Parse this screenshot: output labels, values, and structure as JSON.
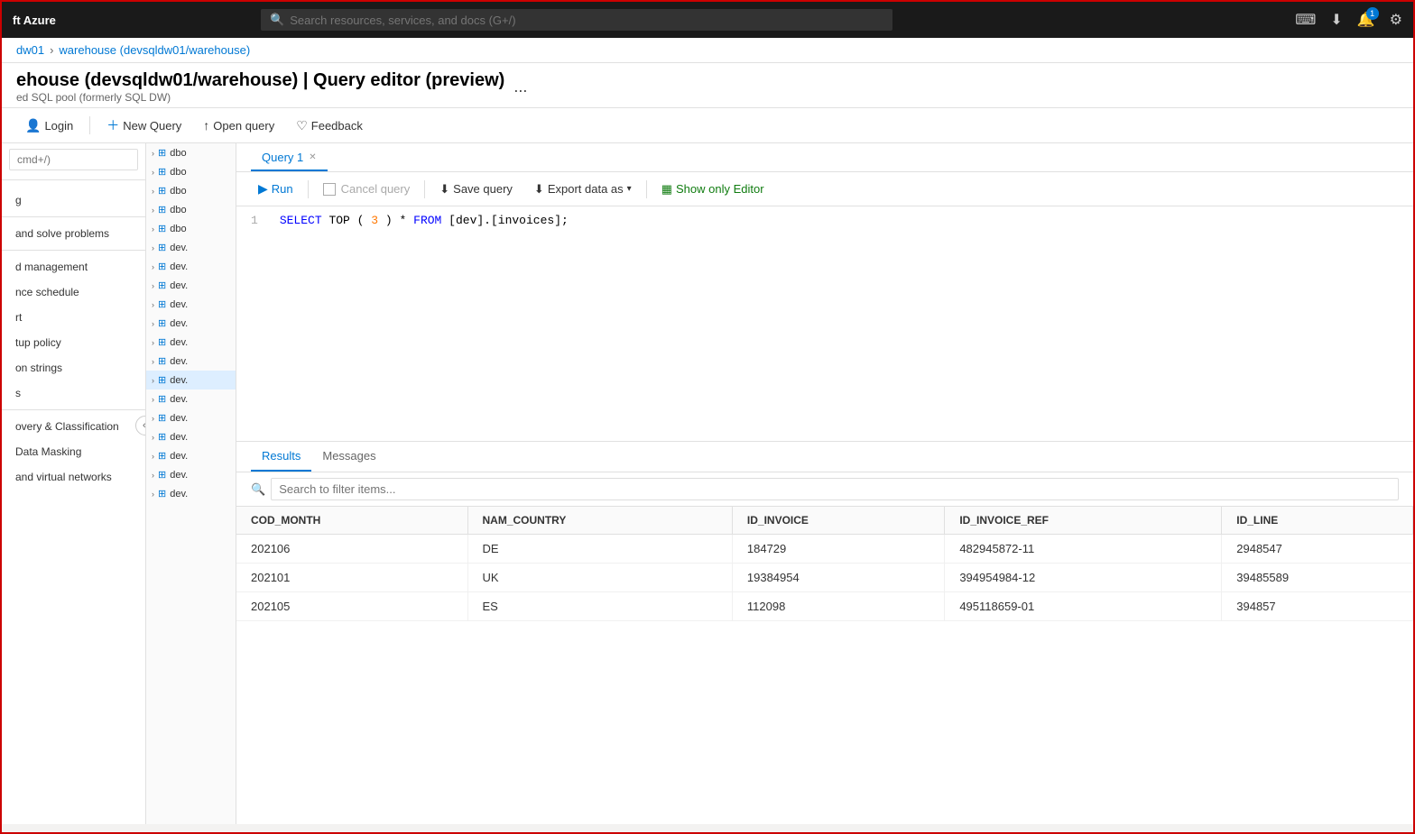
{
  "topbar": {
    "brand": "ft Azure",
    "search_placeholder": "Search resources, services, and docs (G+/)",
    "notification_count": "1"
  },
  "breadcrumb": {
    "parent": "dw01",
    "current": "warehouse (devsqldw01/warehouse)"
  },
  "page": {
    "title": "ehouse (devsqldw01/warehouse) | Query editor (preview)",
    "subtitle": "ed SQL pool (formerly SQL DW)",
    "ellipsis": "..."
  },
  "toolbar": {
    "login_label": "Login",
    "new_query_label": "New Query",
    "open_query_label": "Open query",
    "feedback_label": "Feedback"
  },
  "sidebar": {
    "search_placeholder": "cmd+/)",
    "items": [
      {
        "label": "g"
      },
      {
        "label": "and solve problems"
      },
      {
        "label": "d management"
      },
      {
        "label": "nce schedule"
      },
      {
        "label": "rt"
      },
      {
        "label": "tup policy"
      },
      {
        "label": "on strings"
      },
      {
        "label": "s"
      },
      {
        "label": "overy & Classification"
      },
      {
        "label": "Data Masking"
      },
      {
        "label": "and virtual networks"
      }
    ]
  },
  "tree": {
    "items": [
      {
        "label": "dbo",
        "selected": false
      },
      {
        "label": "dbo",
        "selected": false
      },
      {
        "label": "dbo",
        "selected": false
      },
      {
        "label": "dbo",
        "selected": false
      },
      {
        "label": "dbo",
        "selected": false
      },
      {
        "label": "dev.",
        "selected": false
      },
      {
        "label": "dev.",
        "selected": false
      },
      {
        "label": "dev.",
        "selected": false
      },
      {
        "label": "dev.",
        "selected": false
      },
      {
        "label": "dev.",
        "selected": false
      },
      {
        "label": "dev.",
        "selected": false
      },
      {
        "label": "dev.",
        "selected": false
      },
      {
        "label": "dev.",
        "selected": true
      },
      {
        "label": "dev.",
        "selected": false
      },
      {
        "label": "dev.",
        "selected": false
      },
      {
        "label": "dev.",
        "selected": false
      },
      {
        "label": "dev.",
        "selected": false
      },
      {
        "label": "dev.",
        "selected": false
      },
      {
        "label": "dev.",
        "selected": false
      }
    ]
  },
  "query_tab": {
    "label": "Query 1"
  },
  "editor": {
    "run_label": "Run",
    "cancel_label": "Cancel query",
    "save_label": "Save query",
    "export_label": "Export data as",
    "show_editor_label": "Show only Editor",
    "line_number": "1",
    "code_line": "SELECT TOP (3) * FROM [dev].[invoices];"
  },
  "results": {
    "tab_results": "Results",
    "tab_messages": "Messages",
    "search_placeholder": "Search to filter items...",
    "columns": [
      "COD_MONTH",
      "NAM_COUNTRY",
      "ID_INVOICE",
      "ID_INVOICE_REF",
      "ID_LINE"
    ],
    "rows": [
      [
        "202106",
        "DE",
        "184729",
        "482945872-11",
        "2948547"
      ],
      [
        "202101",
        "UK",
        "19384954",
        "394954984-12",
        "39485589"
      ],
      [
        "202105",
        "ES",
        "112098",
        "495118659-01",
        "394857"
      ]
    ]
  }
}
